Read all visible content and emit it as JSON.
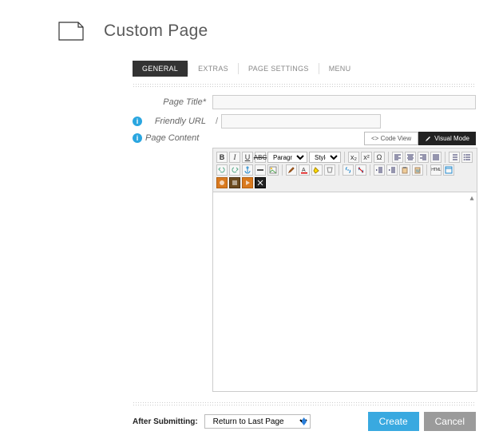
{
  "header": {
    "title": "Custom Page"
  },
  "tabs": [
    {
      "id": "general",
      "label": "GENERAL",
      "active": true
    },
    {
      "id": "extras",
      "label": "EXTRAS",
      "active": false
    },
    {
      "id": "page-settings",
      "label": "PAGE SETTINGS",
      "active": false
    },
    {
      "id": "menu",
      "label": "MENU",
      "active": false
    }
  ],
  "form": {
    "page_title": {
      "label": "Page Title*",
      "value": ""
    },
    "friendly_url": {
      "label": "Friendly URL",
      "prefix": "/",
      "value": ""
    },
    "page_content": {
      "label": "Page Content"
    }
  },
  "editor": {
    "modes": {
      "code": "<> Code View",
      "visual": "Visual Mode"
    },
    "paragraph_label": "Paragraph",
    "styles_label": "Styles",
    "content": ""
  },
  "footer": {
    "after_submitting_label": "After Submitting:",
    "after_submitting_value": "Return to Last Page",
    "create_label": "Create",
    "cancel_label": "Cancel"
  },
  "icons": {
    "bold": "B",
    "italic": "I",
    "underline": "U",
    "strike": "ABC",
    "sub": "x₂",
    "sup": "x²",
    "omega": "Ω",
    "html": "HTML"
  }
}
